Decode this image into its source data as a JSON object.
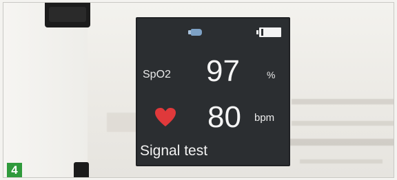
{
  "step": {
    "number": "4",
    "badge_color": "#2f9a3c"
  },
  "device_screen": {
    "background": "#2b2e31",
    "status_bar": {
      "probe_icon": "finger-probe-icon",
      "probe_color": "#7ea2c6",
      "battery_icon": "battery-icon",
      "battery_level": 0.85
    },
    "spo2": {
      "label": "SpO2",
      "value": "97",
      "unit": "%"
    },
    "pulse_rate": {
      "icon": "heart-icon",
      "icon_color": "#e0393b",
      "value": "80",
      "unit": "bpm"
    },
    "status_message": "Signal test"
  }
}
